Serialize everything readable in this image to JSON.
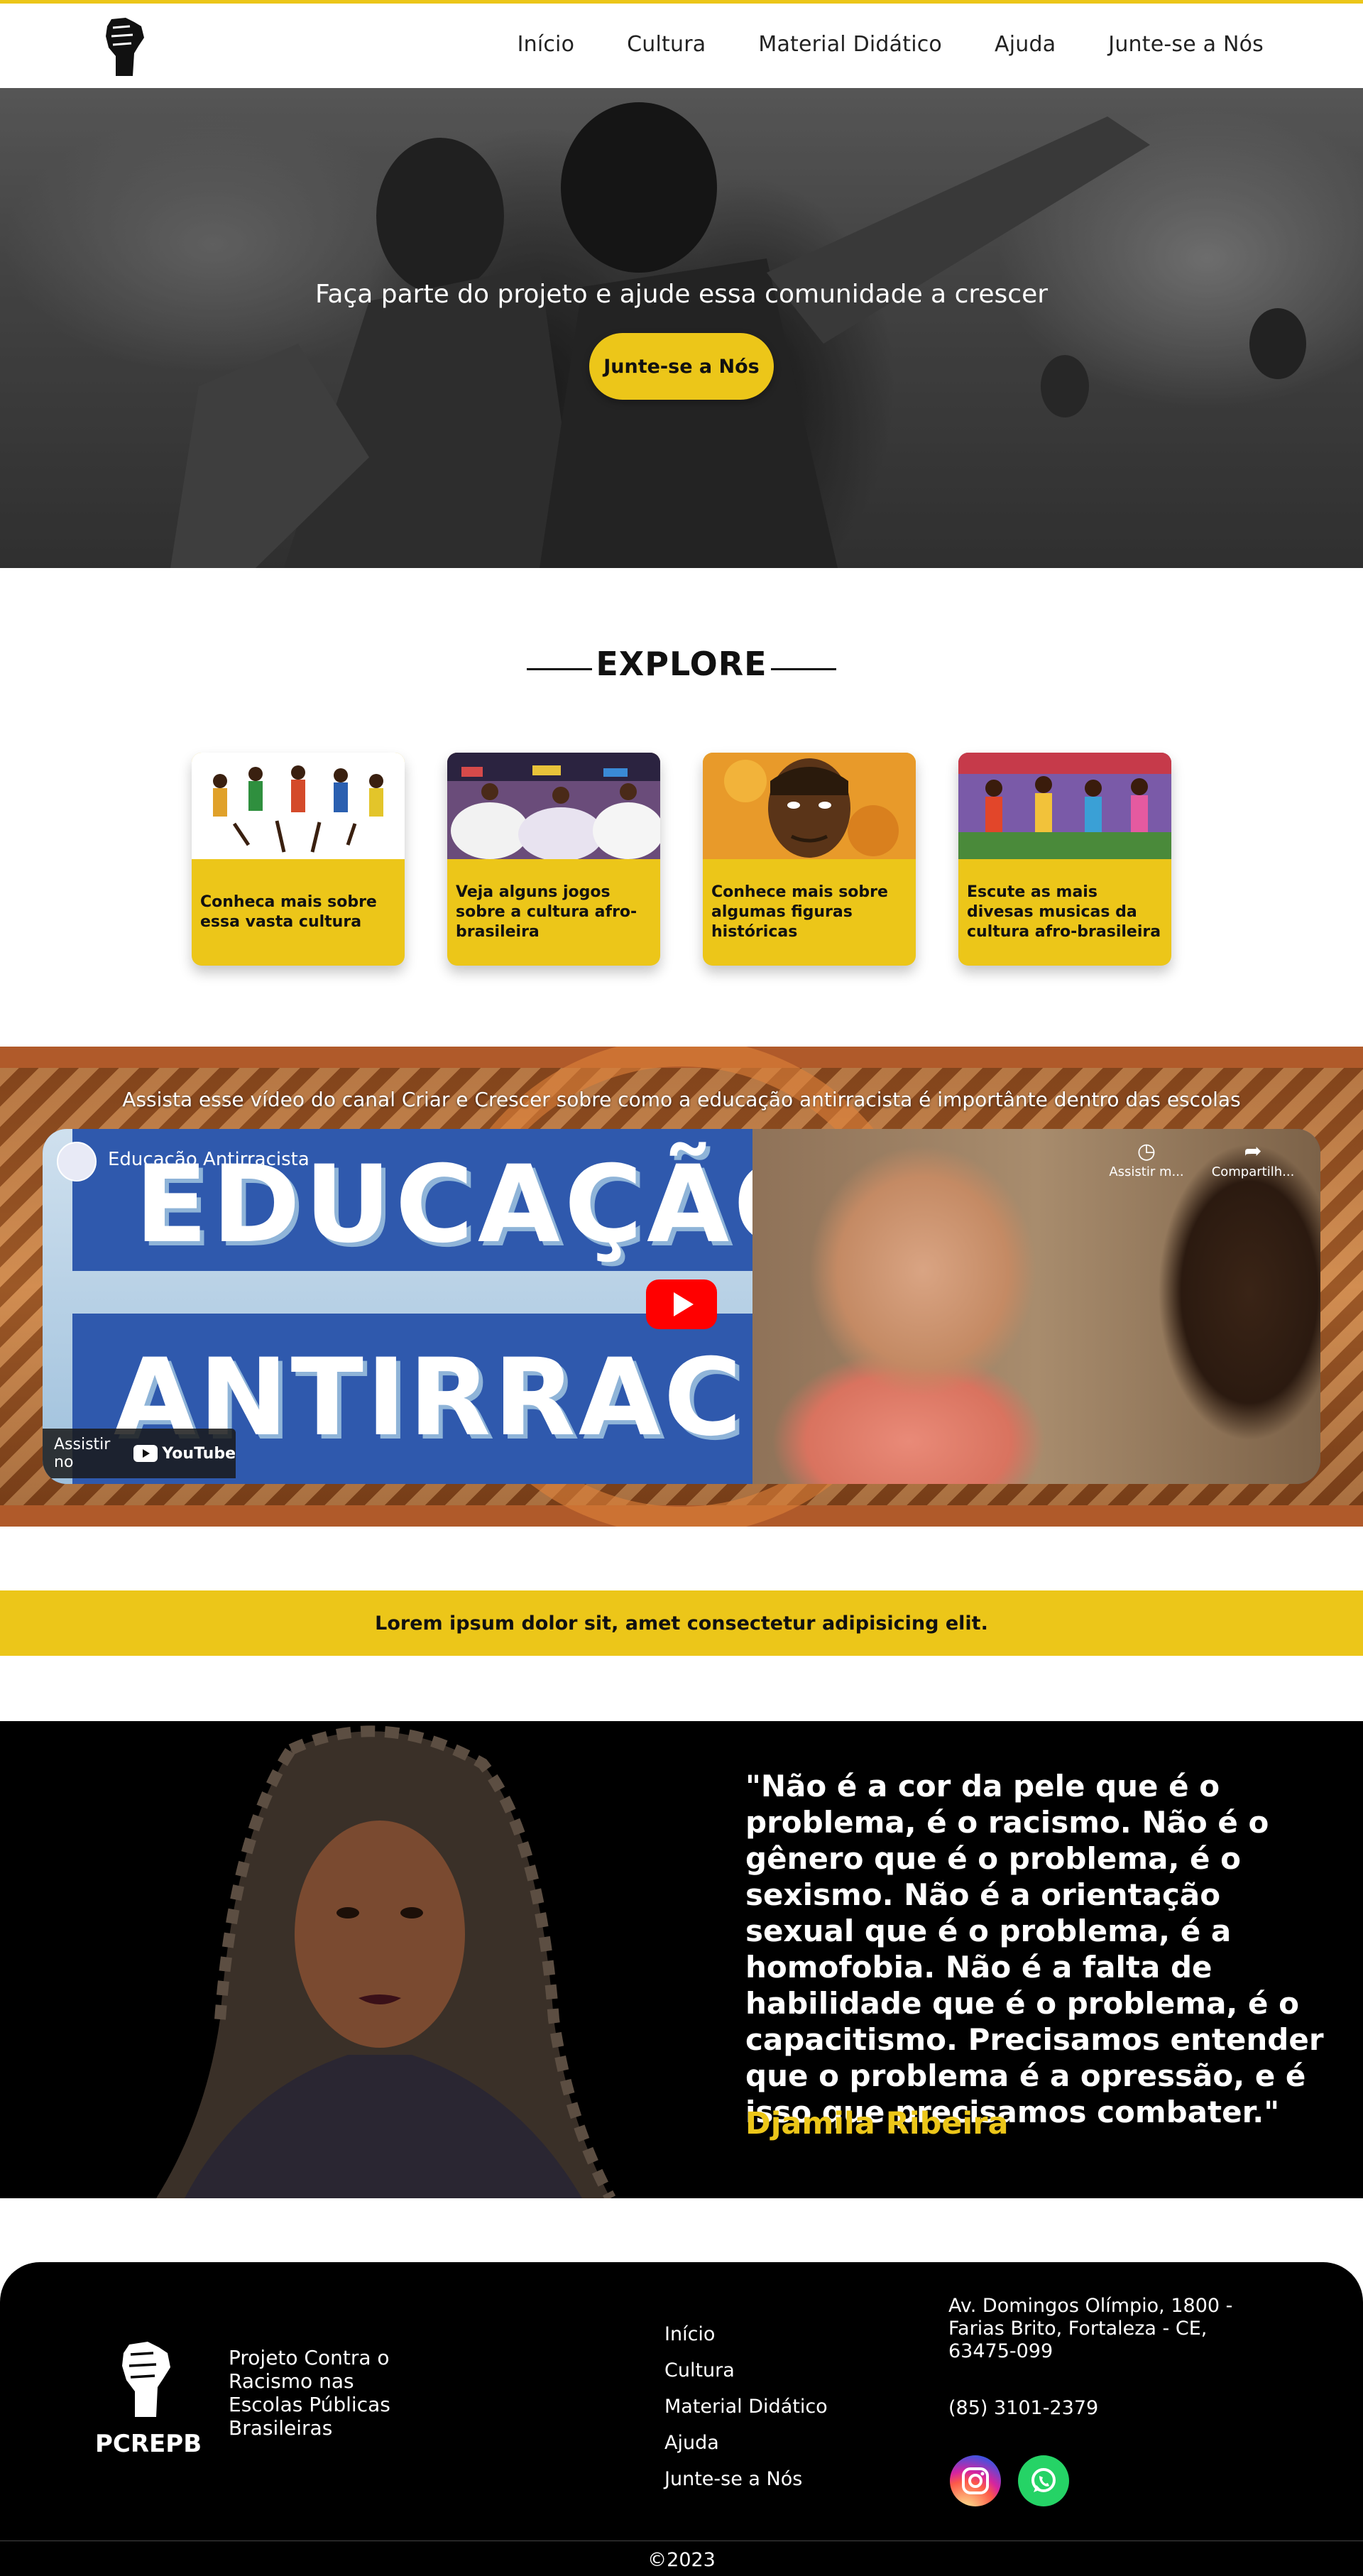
{
  "nav": {
    "items": [
      "Início",
      "Cultura",
      "Material Didático",
      "Ajuda",
      "Junte-se a Nós"
    ]
  },
  "hero": {
    "text": "Faça parte do projeto e ajude essa comunidade a crescer",
    "button_label": "Junte-se a Nós"
  },
  "explore": {
    "title": "EXPLORE",
    "cards": [
      {
        "text": "Conheca mais sobre essa vasta cultura"
      },
      {
        "text": "Veja alguns jogos sobre a cultura afro-brasileira"
      },
      {
        "text": "Conhece mais sobre algumas figuras históricas"
      },
      {
        "text": "Escute as mais divesas musicas da cultura afro-brasileira"
      }
    ]
  },
  "video": {
    "caption": "Assista esse vídeo do canal Criar e Crescer sobre como a educação antirracista é importânte dentro das escolas",
    "title": "Educação Antirracista",
    "thumb_word1": "EDUCAÇÃO",
    "thumb_word2": "ANTIRRACISTA",
    "watch_later": "Assistir m...",
    "share": "Compartilh...",
    "watch_on": "Assistir no",
    "youtube": "YouTube"
  },
  "band": {
    "text": "Lorem ipsum dolor sit, amet consectetur adipisicing elit."
  },
  "quote": {
    "text": "\"Não é a cor da pele que é o problema, é o racismo. Não é o gênero que é o problema, é o sexismo. Não é a orientação sexual que é o problema, é a homofobia. Não é a falta de habilidade que é o problema, é o capacitismo. Precisamos entender que o problema é a opressão, e é isso que precisamos combater.\"",
    "author": "Djamila Ribeira"
  },
  "footer": {
    "brand": "PCREPB",
    "description": "Projeto Contra o Racismo nas Escolas Públicas Brasileiras",
    "links": [
      "Início",
      "Cultura",
      "Material Didático",
      "Ajuda",
      "Junte-se a Nós"
    ],
    "address": "Av. Domingos Olímpio, 1800 - Farias Brito, Fortaleza - CE, 63475-099",
    "phone": "(85) 3101-2379",
    "copyright": "©2023"
  },
  "colors": {
    "accent": "#ecc619",
    "dark": "#000000"
  },
  "icons": [
    "fist-logo-icon",
    "play-icon",
    "clock-icon",
    "share-icon",
    "instagram-icon",
    "whatsapp-icon"
  ]
}
